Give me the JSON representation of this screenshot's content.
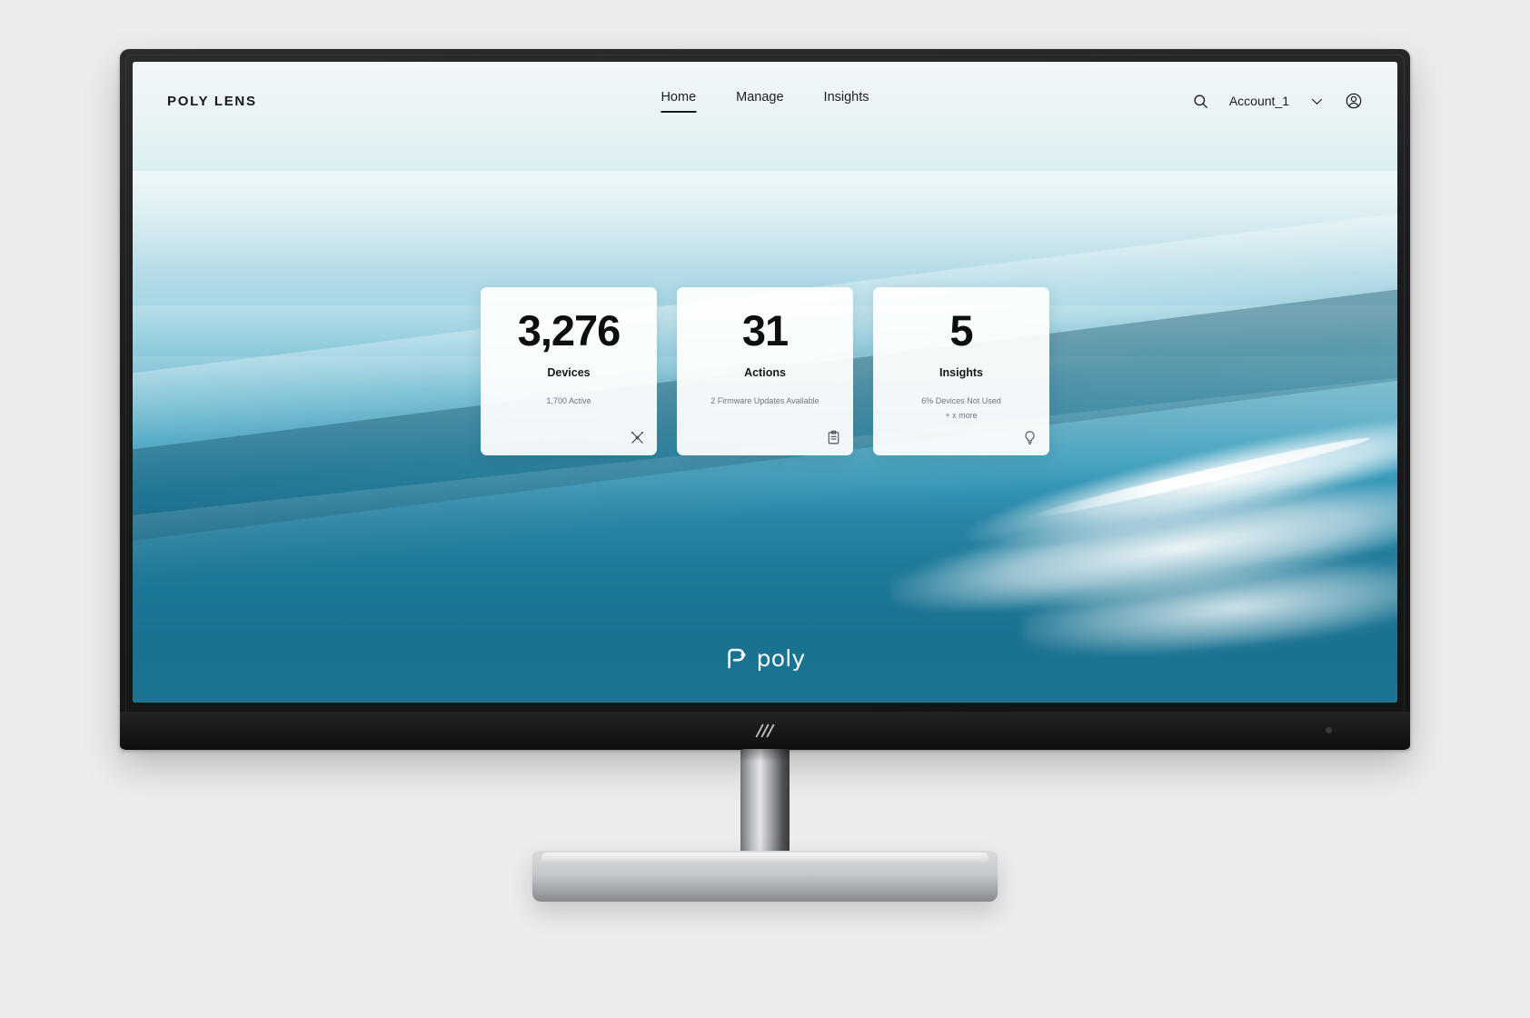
{
  "app": {
    "brand": "POLY LENS",
    "watermark_text": "poly"
  },
  "header": {
    "nav": [
      {
        "label": "Home",
        "active": true
      },
      {
        "label": "Manage",
        "active": false
      },
      {
        "label": "Insights",
        "active": false
      }
    ],
    "search_icon": "search-icon",
    "account_name": "Account_1",
    "chevron_icon": "chevron-down-icon",
    "avatar_icon": "account-avatar-icon"
  },
  "cards": [
    {
      "value": "3,276",
      "label": "Devices",
      "sub_lines": [
        "1,700 Active"
      ],
      "icon": "devices-network-icon"
    },
    {
      "value": "31",
      "label": "Actions",
      "sub_lines": [
        "2 Firmware Updates Available"
      ],
      "icon": "clipboard-icon"
    },
    {
      "value": "5",
      "label": "Insights",
      "sub_lines": [
        "6% Devices Not Used",
        "+ x more"
      ],
      "icon": "lightbulb-icon"
    }
  ],
  "hardware": {
    "vendor_logo": "hp-logo",
    "bezel_color": "#1c1c1e",
    "stand_color": "#c6c9cc"
  },
  "theme": {
    "page_background": "#ececec",
    "card_background": "#ffffff",
    "text_primary": "#17181a",
    "text_muted": "#6e757a",
    "ocean_light": "#cfe8ee",
    "ocean_deep": "#1b7594"
  }
}
